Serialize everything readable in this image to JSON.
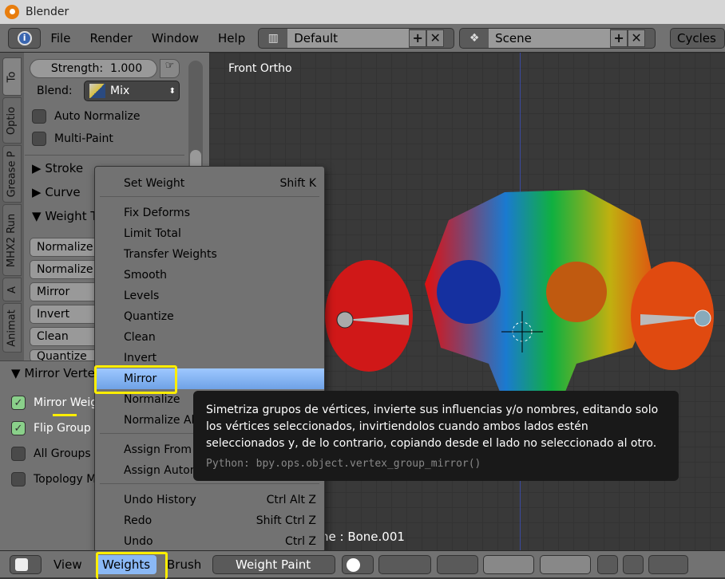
{
  "window": {
    "title": "Blender"
  },
  "menubar": {
    "items": [
      "File",
      "Render",
      "Window",
      "Help"
    ],
    "layout": "Default",
    "scene": "Scene",
    "engine": "Cycles"
  },
  "left_panel": {
    "tabs": [
      "To",
      "Optio",
      "Grease P",
      "MHX2 Run",
      "A",
      "Animat"
    ],
    "strength_label": "Strength:",
    "strength_value": "1.000",
    "blend_label": "Blend:",
    "blend_value": "Mix",
    "auto_normalize": "Auto Normalize",
    "multi_paint": "Multi-Paint",
    "stroke": "Stroke",
    "curve": "Curve",
    "weight_tools": "Weight Tools",
    "buttons": [
      "Normalize",
      "Normalize",
      "Mirror",
      "Invert",
      "Clean",
      "Quantize"
    ],
    "mirror_section": "Mirror Vertex Group",
    "options": [
      {
        "label": "Mirror Weights",
        "checked": true
      },
      {
        "label": "Flip Group Names",
        "checked": true
      },
      {
        "label": "All Groups",
        "checked": false
      },
      {
        "label": "Topology Mirror",
        "checked": false
      }
    ]
  },
  "viewport": {
    "view_label": "Front Ortho",
    "bone_label": "ne : Bone.001"
  },
  "menu": {
    "items": [
      {
        "label": "Set Weight",
        "shortcut": "Shift K"
      },
      {
        "label": "Fix Deforms",
        "shortcut": ""
      },
      {
        "label": "Limit Total",
        "shortcut": ""
      },
      {
        "label": "Transfer Weights",
        "shortcut": ""
      },
      {
        "label": "Smooth",
        "shortcut": ""
      },
      {
        "label": "Levels",
        "shortcut": ""
      },
      {
        "label": "Quantize",
        "shortcut": ""
      },
      {
        "label": "Clean",
        "shortcut": ""
      },
      {
        "label": "Invert",
        "shortcut": ""
      },
      {
        "label": "Mirror",
        "shortcut": "",
        "highlighted": true
      },
      {
        "label": "Normalize",
        "shortcut": ""
      },
      {
        "label": "Normalize All",
        "shortcut": ""
      },
      {
        "label": "Assign From Bone Envelopes",
        "shortcut": ""
      },
      {
        "label": "Assign Automatic From Bones",
        "shortcut": ""
      },
      {
        "label": "Undo History",
        "shortcut": "Ctrl Alt Z"
      },
      {
        "label": "Redo",
        "shortcut": "Shift Ctrl Z"
      },
      {
        "label": "Undo",
        "shortcut": "Ctrl Z"
      }
    ]
  },
  "tooltip": {
    "text": "Simetriza grupos de vértices, invierte sus influencias y/o nombres, editando solo los vértices seleccionados, invirtiendolos cuando ambos lados estén seleccionados y, de lo contrario, copiando desde el lado no seleccionado al otro.",
    "python": "Python: bpy.ops.object.vertex_group_mirror()"
  },
  "bottombar": {
    "view": "View",
    "weights": "Weights",
    "brush": "Brush",
    "mode": "Weight Paint"
  },
  "colors": {
    "highlight": "#8ab8f5",
    "annotation": "#ffee00",
    "checkbox_on": "#8ad08a"
  }
}
